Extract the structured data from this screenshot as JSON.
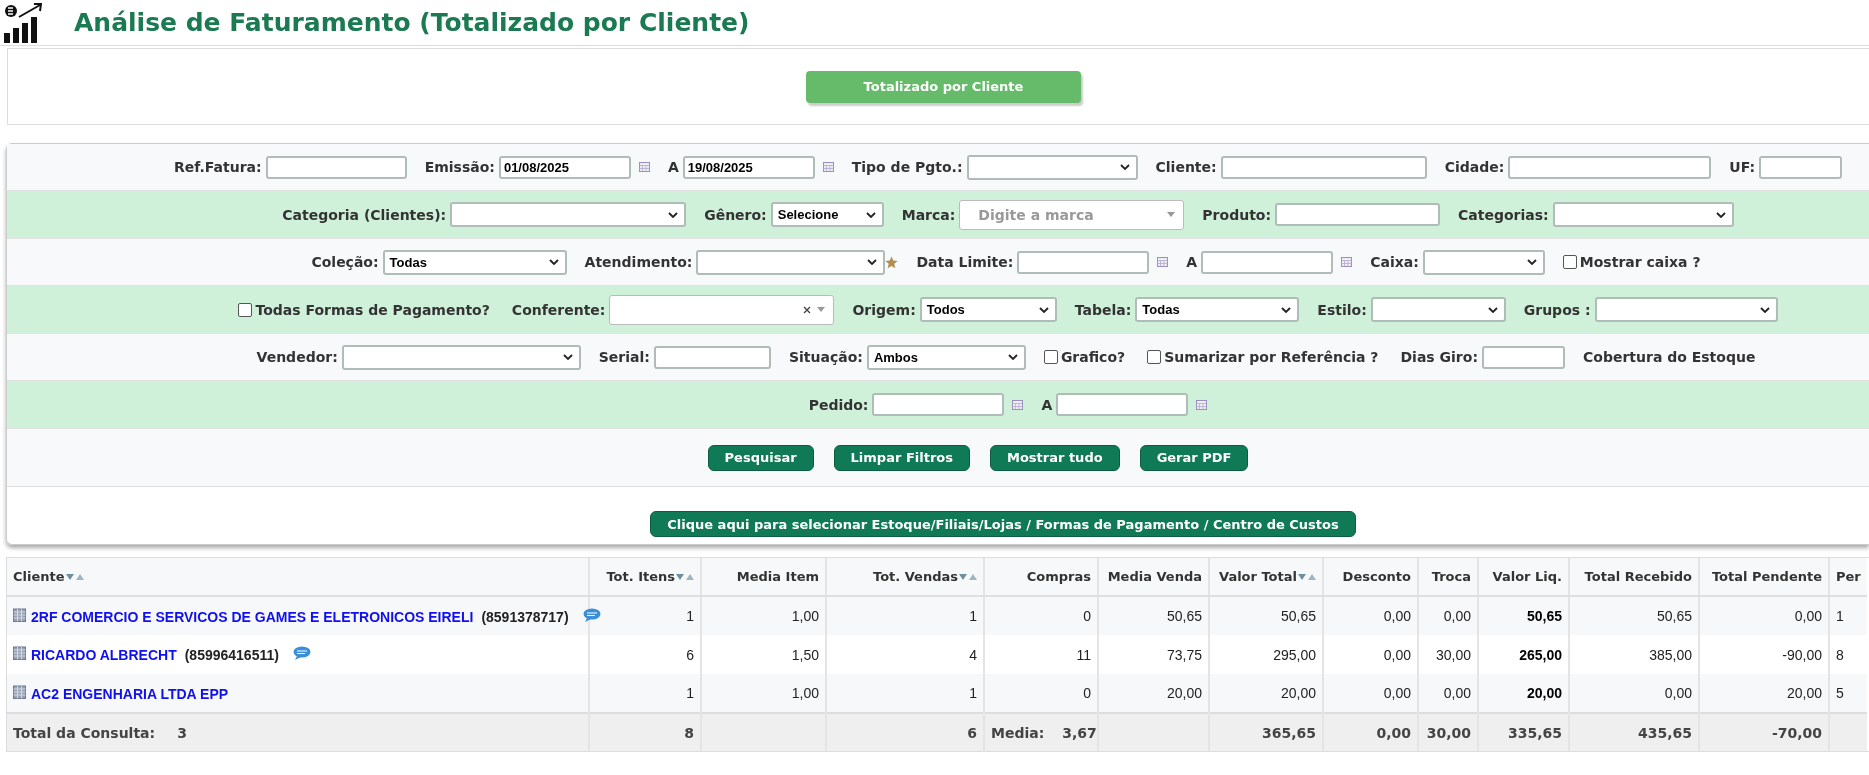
{
  "page": {
    "title": "Análise de Faturamento (Totalizado por Cliente)"
  },
  "mode_button": "Totalizado por Cliente",
  "filter_rows": [
    [
      {
        "kind": "label",
        "text": "Ref.Fatura:"
      },
      {
        "kind": "text"
      },
      {
        "kind": "label",
        "text": "Emissão:"
      },
      {
        "kind": "date",
        "value": "01/08/2025"
      },
      {
        "kind": "label",
        "text": "A"
      },
      {
        "kind": "date",
        "value": "19/08/2025"
      },
      {
        "kind": "label",
        "text": "Tipo de Pgto.:"
      },
      {
        "kind": "select"
      },
      {
        "kind": "label",
        "text": "Cliente:"
      },
      {
        "kind": "text"
      },
      {
        "kind": "label",
        "text": "Cidade:"
      },
      {
        "kind": "text"
      },
      {
        "kind": "label",
        "text": "UF:"
      },
      {
        "kind": "text"
      }
    ],
    [
      {
        "kind": "label",
        "text": "Categoria (Clientes):"
      },
      {
        "kind": "select"
      },
      {
        "kind": "label",
        "text": "Gênero:"
      },
      {
        "kind": "select",
        "value": "Selecione"
      },
      {
        "kind": "label",
        "text": "Marca:"
      },
      {
        "kind": "combo",
        "placeholder": "Digite a marca",
        "clearable": false
      },
      {
        "kind": "label",
        "text": "Produto:"
      },
      {
        "kind": "text"
      },
      {
        "kind": "label",
        "text": "Categorias:"
      },
      {
        "kind": "select"
      }
    ],
    [
      {
        "kind": "label",
        "text": "Coleção:"
      },
      {
        "kind": "select",
        "value": "Todas"
      },
      {
        "kind": "label",
        "text": "Atendimento:"
      },
      {
        "kind": "select"
      },
      {
        "kind": "star"
      },
      {
        "kind": "label",
        "text": "Data Limite:"
      },
      {
        "kind": "date"
      },
      {
        "kind": "label",
        "text": "A"
      },
      {
        "kind": "date"
      },
      {
        "kind": "label",
        "text": "Caixa:"
      },
      {
        "kind": "select"
      },
      {
        "kind": "checkbox",
        "text": "Mostrar caixa ?",
        "checked": false
      }
    ],
    [
      {
        "kind": "checkbox",
        "text": "Todas Formas de Pagamento?",
        "checked": false
      },
      {
        "kind": "label",
        "text": "Conferente:"
      },
      {
        "kind": "combo",
        "clearable": true
      },
      {
        "kind": "label",
        "text": "Origem:"
      },
      {
        "kind": "select",
        "value": "Todos"
      },
      {
        "kind": "label",
        "text": "Tabela:"
      },
      {
        "kind": "select",
        "value": "Todas"
      },
      {
        "kind": "label",
        "text": "Estilo:"
      },
      {
        "kind": "select"
      },
      {
        "kind": "label",
        "text": "Grupos :"
      },
      {
        "kind": "select"
      }
    ],
    [
      {
        "kind": "label",
        "text": "Vendedor:"
      },
      {
        "kind": "select"
      },
      {
        "kind": "label",
        "text": "Serial:"
      },
      {
        "kind": "text"
      },
      {
        "kind": "label",
        "text": "Situação:"
      },
      {
        "kind": "select",
        "value": "Ambos"
      },
      {
        "kind": "checkbox",
        "text": "Grafico?",
        "checked": false
      },
      {
        "kind": "checkbox",
        "text": "Sumarizar por Referência ?",
        "checked": false
      },
      {
        "kind": "label",
        "text": "Dias Giro:"
      },
      {
        "kind": "text"
      },
      {
        "kind": "label",
        "text": "Cobertura do Estoque"
      }
    ],
    [
      {
        "kind": "label",
        "text": "Pedido:"
      },
      {
        "kind": "date"
      },
      {
        "kind": "label",
        "text": "A"
      },
      {
        "kind": "date"
      }
    ]
  ],
  "actions": [
    "Pesquisar",
    "Limpar Filtros",
    "Mostrar tudo",
    "Gerar PDF"
  ],
  "selection_button": "Clique aqui para selecionar Estoque/Filiais/Lojas / Formas de Pagamento / Centro de Custos",
  "table": {
    "columns": [
      {
        "label": "Cliente",
        "sortable": true
      },
      {
        "label": "Tot. Itens",
        "sortable": true
      },
      {
        "label": "Media Item",
        "sortable": false
      },
      {
        "label": "Tot. Vendas",
        "sortable": true
      },
      {
        "label": "Compras",
        "sortable": false
      },
      {
        "label": "Media Venda",
        "sortable": false
      },
      {
        "label": "Valor Total",
        "sortable": true
      },
      {
        "label": "Desconto",
        "sortable": false
      },
      {
        "label": "Troca",
        "sortable": false
      },
      {
        "label": "Valor Liq.",
        "sortable": false,
        "emphasis": true
      },
      {
        "label": "Total Recebido",
        "sortable": false
      },
      {
        "label": "Total Pendente",
        "sortable": false
      },
      {
        "label": "Per",
        "sortable": false
      }
    ],
    "rows": [
      {
        "cells": [
          {
            "client": "2RF COMERCIO E SERVICOS DE GAMES E ELETRONICOS EIRELI",
            "phone": "(8591378717)",
            "sms": true
          },
          "1",
          "1,00",
          "1",
          "0",
          "50,65",
          "50,65",
          "0,00",
          "0,00",
          "50,65",
          "50,65",
          "0,00",
          "1"
        ]
      },
      {
        "cells": [
          {
            "client": "RICARDO ALBRECHT",
            "phone": "(85996416511)",
            "sms": true
          },
          "6",
          "1,50",
          "4",
          "11",
          "73,75",
          "295,00",
          "0,00",
          "30,00",
          "265,00",
          "385,00",
          "-90,00",
          "8"
        ]
      },
      {
        "cells": [
          {
            "client": "AC2 ENGENHARIA LTDA EPP",
            "sms": false
          },
          "1",
          "1,00",
          "1",
          "0",
          "20,00",
          "20,00",
          "0,00",
          "0,00",
          "20,00",
          "0,00",
          "20,00",
          "5"
        ]
      }
    ],
    "total": {
      "cells": [
        {
          "label": "Total da Consulta:",
          "count": "3"
        },
        "8",
        "",
        "6",
        {
          "label": "Media:",
          "value": "3,67"
        },
        "",
        "365,65",
        "0,00",
        "30,00",
        "335,65",
        "435,65",
        "-70,00",
        ""
      ]
    }
  }
}
